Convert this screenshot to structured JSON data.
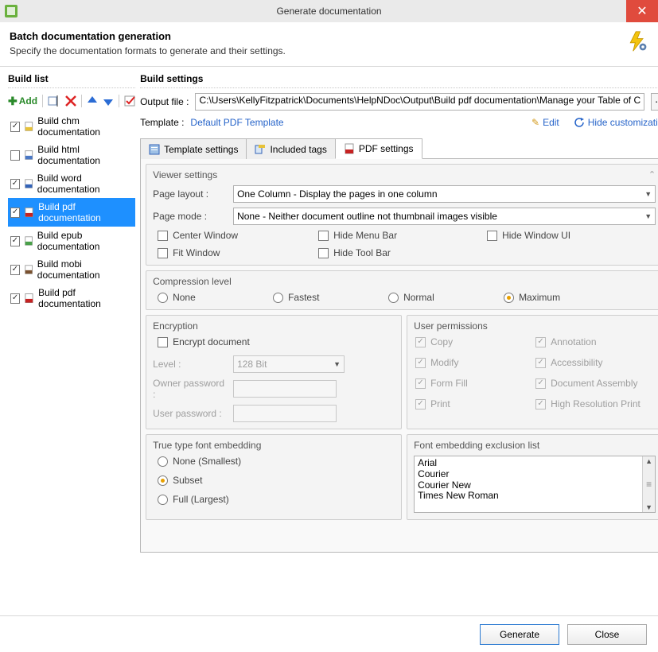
{
  "window": {
    "title": "Generate documentation"
  },
  "header": {
    "title": "Batch documentation generation",
    "subtitle": "Specify the documentation formats to generate and their settings."
  },
  "sidebar": {
    "title": "Build list",
    "add_label": "Add",
    "items": [
      {
        "label": "Build chm documentation",
        "checked": true,
        "selected": false,
        "icon": "chm"
      },
      {
        "label": "Build html documentation",
        "checked": false,
        "selected": false,
        "icon": "html"
      },
      {
        "label": "Build word documentation",
        "checked": true,
        "selected": false,
        "icon": "word"
      },
      {
        "label": "Build pdf documentation",
        "checked": true,
        "selected": true,
        "icon": "pdf"
      },
      {
        "label": "Build epub documentation",
        "checked": true,
        "selected": false,
        "icon": "epub"
      },
      {
        "label": "Build mobi documentation",
        "checked": true,
        "selected": false,
        "icon": "mobi"
      },
      {
        "label": "Build pdf documentation",
        "checked": true,
        "selected": false,
        "icon": "pdf"
      }
    ]
  },
  "settings": {
    "title": "Build settings",
    "output_label": "Output file :",
    "output_value": "C:\\Users\\KellyFitzpatrick\\Documents\\HelpNDoc\\Output\\Build pdf documentation\\Manage your Table of C",
    "template_label": "Template :",
    "template_value": "Default PDF Template",
    "edit_label": "Edit",
    "hide_label": "Hide customization",
    "tabs": [
      {
        "label": "Template settings",
        "active": false
      },
      {
        "label": "Included tags",
        "active": false
      },
      {
        "label": "PDF settings",
        "active": true
      }
    ],
    "viewer": {
      "title": "Viewer settings",
      "page_layout_label": "Page layout :",
      "page_layout_value": "One Column - Display the pages in one column",
      "page_mode_label": "Page mode :",
      "page_mode_value": "None - Neither document outline not thumbnail images visible",
      "opts": {
        "center_window": "Center Window",
        "fit_window": "Fit Window",
        "hide_menu": "Hide Menu Bar",
        "hide_tool": "Hide Tool Bar",
        "hide_window_ui": "Hide Window UI"
      }
    },
    "compression": {
      "title": "Compression level",
      "options": [
        "None",
        "Fastest",
        "Normal",
        "Maximum"
      ],
      "selected": "Maximum"
    },
    "encryption": {
      "title": "Encryption",
      "encrypt_label": "Encrypt document",
      "level_label": "Level :",
      "level_value": "128 Bit",
      "owner_pw_label": "Owner password :",
      "user_pw_label": "User password :"
    },
    "permissions": {
      "title": "User permissions",
      "items": [
        "Copy",
        "Annotation",
        "Modify",
        "Accessibility",
        "Form Fill",
        "Document Assembly",
        "Print",
        "High Resolution Print"
      ]
    },
    "font_embed": {
      "title": "True type font embedding",
      "options": [
        "None (Smallest)",
        "Subset",
        "Full (Largest)"
      ],
      "selected": "Subset"
    },
    "font_excl": {
      "title": "Font embedding exclusion list",
      "items": [
        "Arial",
        "Courier",
        "Courier New",
        "Times New Roman"
      ]
    }
  },
  "footer": {
    "generate": "Generate",
    "close": "Close"
  }
}
